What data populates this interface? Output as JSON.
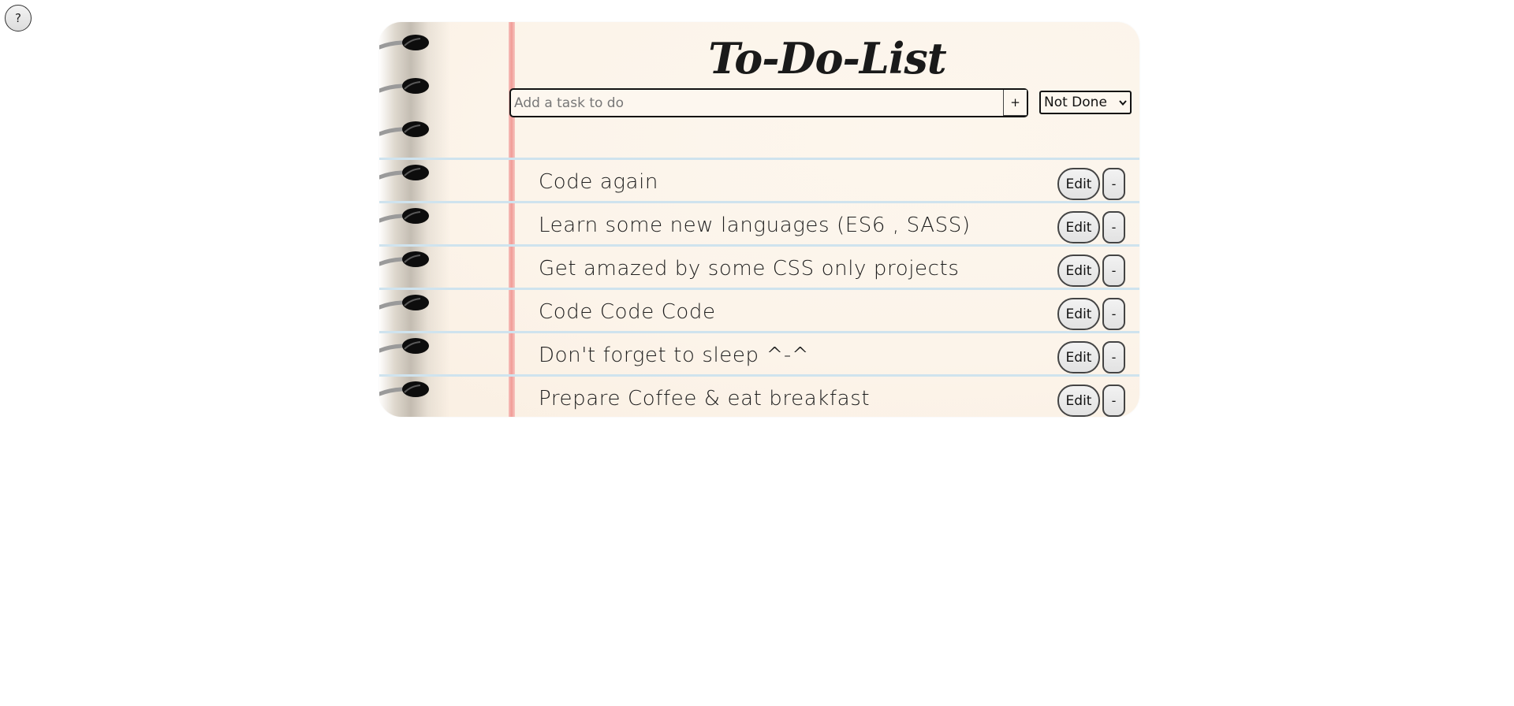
{
  "help": {
    "label": "?"
  },
  "header": {
    "title": "To-Do-List"
  },
  "form": {
    "placeholder": "Add a task to do",
    "value": "",
    "add_label": "+",
    "filter_selected": "Not Done"
  },
  "tasks": [
    {
      "text": "Code again",
      "edit_label": "Edit",
      "remove_label": "-"
    },
    {
      "text": "Learn some new languages (ES6 , SASS)",
      "edit_label": "Edit",
      "remove_label": "-"
    },
    {
      "text": "Get amazed by some CSS only projects",
      "edit_label": "Edit",
      "remove_label": "-"
    },
    {
      "text": "Code Code Code",
      "edit_label": "Edit",
      "remove_label": "-"
    },
    {
      "text": "Don't forget to sleep ^-^",
      "edit_label": "Edit",
      "remove_label": "-"
    },
    {
      "text": "Prepare Coffee & eat breakfast",
      "edit_label": "Edit",
      "remove_label": "-"
    }
  ],
  "colors": {
    "paper": "#fcf4ea",
    "margin_line": "#f19b96",
    "rule_line": "#cfe3ee",
    "ink": "#1e1e1e"
  }
}
